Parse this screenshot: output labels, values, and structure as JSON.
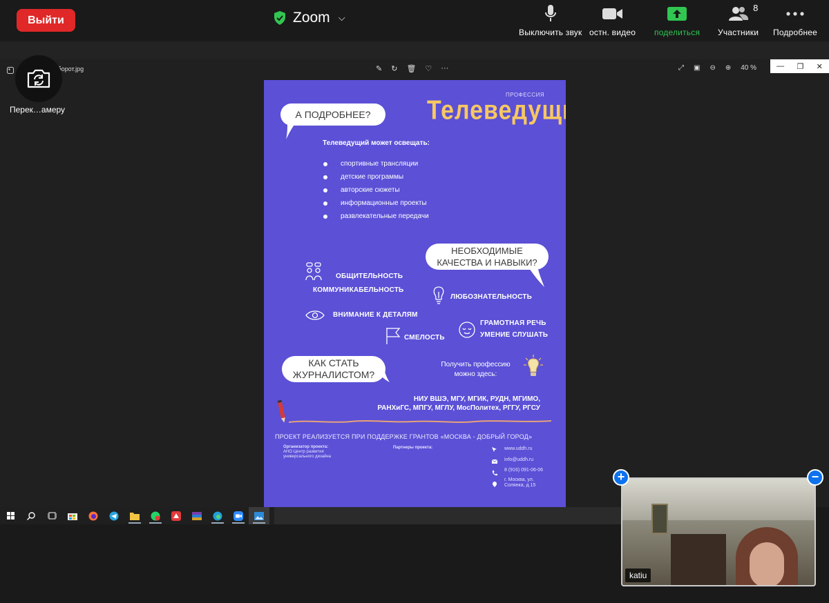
{
  "topbar": {
    "leave_label": "Выйти",
    "meeting_title": "Zoom",
    "controls": {
      "mute": "Выключить звук",
      "video": "остн. видео",
      "share": "поделиться",
      "participants": "Участники",
      "participants_count": "8",
      "more": "Подробнее"
    },
    "colors": {
      "leave": "#e02828",
      "share": "#31c652",
      "shield": "#31c652"
    }
  },
  "viewer": {
    "filename": "ий оборот.jpg",
    "zoom_level": "40 %",
    "switch_camera_label": "Перек…амеру"
  },
  "poster": {
    "profession_tag": "ПРОФЕССИЯ",
    "title": "Телеведущий",
    "bubble_more": "А ПОДРОБНЕЕ?",
    "can_cover": "Телеведущий может освещать:",
    "topics": [
      "спортивные трансляции",
      "детские программы",
      "авторские сюжеты",
      "информационные проекты",
      "развлекательные передачи"
    ],
    "bubble_skills_line1": "НЕОБХОДИМЫЕ",
    "bubble_skills_line2": "КАЧЕСТВА И НАВЫКИ?",
    "skills": {
      "sociability": "ОБЩИТЕЛЬНОСТЬ",
      "communicativeness": "КОММУНИКАБЕЛЬНОСТЬ",
      "curiosity": "ЛЮБОЗНАТЕЛЬНОСТЬ",
      "attention": "ВНИМАНИЕ К ДЕТАЛЯМ",
      "courage": "СМЕЛОСТЬ",
      "speech": "ГРАМОТНАЯ РЕЧЬ",
      "listening": "УМЕНИЕ СЛУШАТЬ"
    },
    "bubble_journalist_line1": "КАК СТАТЬ",
    "bubble_journalist_line2": "ЖУРНАЛИСТОМ?",
    "get_profession_line1": "Получить профессию",
    "get_profession_line2": "можно здесь:",
    "universities_line1": "НИУ ВШЭ, МГУ,  МГИК, РУДН, МГИМО,",
    "universities_line2": "РАНХиГС, МПГУ, МГЛУ, МосПолитех, РГГУ, РГСУ",
    "grant": "ПРОЕКТ РЕАЛИЗУЕТСЯ ПРИ ПОДДЕРЖКЕ ГРАНТОВ «МОСКВА - ДОБРЫЙ ГОРОД»",
    "organizer_label": "Организатор проекта:",
    "organizer_line1": "АНО Центр развития",
    "organizer_line2": "универсального дизайна",
    "partners_label": "Партнеры проекта:",
    "website": "www.uddh.ru",
    "email": "info@uddh.ru",
    "phone": "8 (916) 091-06-06",
    "address_line1": "г. Москва, ул.",
    "address_line2": "Солянка, д.15",
    "colors": {
      "background": "#5b50d6",
      "title": "#f7c862"
    }
  },
  "video_tile": {
    "participant_name": "katiu"
  }
}
